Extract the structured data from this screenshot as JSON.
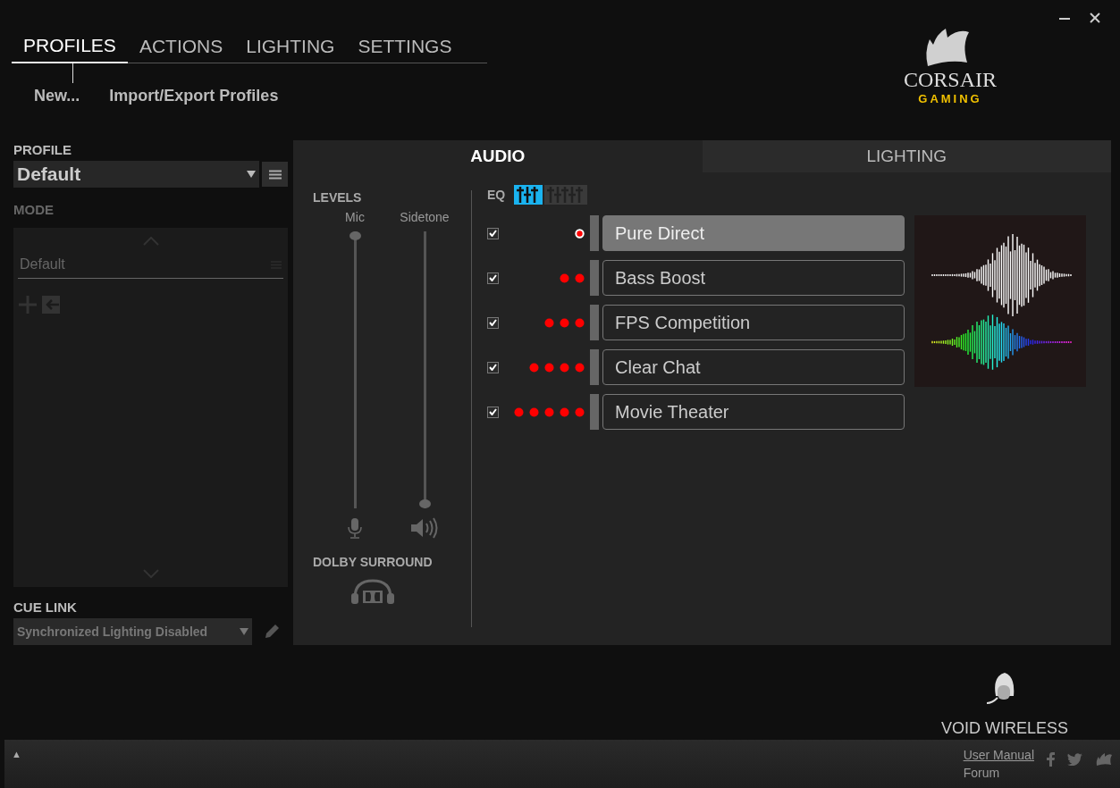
{
  "nav": {
    "tabs": [
      {
        "label": "PROFILES",
        "selected": true
      },
      {
        "label": "ACTIONS",
        "selected": false
      },
      {
        "label": "LIGHTING",
        "selected": false
      },
      {
        "label": "SETTINGS",
        "selected": false
      }
    ]
  },
  "profile_actions": [
    "New...",
    "Import/Export Profiles"
  ],
  "logo": {
    "brand": "CORSAIR",
    "tagline": "GAMING"
  },
  "sidebar": {
    "profile_label": "PROFILE",
    "profile": "Default",
    "mode_label": "MODE",
    "modes": [
      {
        "label": "Default"
      }
    ],
    "cue_link_label": "CUE LINK",
    "cue_link": "Synchronized Lighting Disabled"
  },
  "panel": {
    "tabs": [
      {
        "label": "AUDIO",
        "selected": true
      },
      {
        "label": "LIGHTING",
        "selected": false
      }
    ],
    "levels": {
      "title": "LEVELS",
      "sliders": [
        {
          "label": "Mic",
          "kind": "mic",
          "level": 1
        },
        {
          "label": "Sidetone",
          "kind": "speaker",
          "level": 0
        }
      ]
    },
    "dolby": {
      "title": "DOLBY SURROUND"
    },
    "eq": {
      "label": "EQ",
      "views": [
        {
          "kind": "three",
          "selected": true
        },
        {
          "kind": "five",
          "selected": false
        }
      ],
      "presets": [
        {
          "name": "Pure Direct",
          "checked": true,
          "selected": true
        },
        {
          "name": "Bass Boost",
          "checked": true,
          "selected": false
        },
        {
          "name": "FPS Competition",
          "checked": true,
          "selected": false
        },
        {
          "name": "Clear Chat",
          "checked": true,
          "selected": false
        },
        {
          "name": "Movie Theater",
          "checked": true,
          "selected": false
        }
      ]
    }
  },
  "device": {
    "name": "VOID WIRELESS"
  },
  "footer": {
    "toggle": "▲",
    "links": [
      "User Manual",
      "Forum"
    ]
  }
}
